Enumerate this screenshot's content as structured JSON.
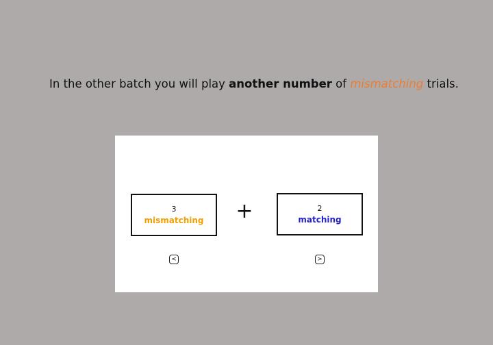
{
  "instruction": {
    "prefix": "In the other batch you will play ",
    "emphasis": "another number",
    "middle": " of ",
    "highlight": "mismatching",
    "suffix": " trials."
  },
  "options": [
    {
      "count": "3",
      "label": "mismatching",
      "key": "<"
    },
    {
      "count": "2",
      "label": "matching",
      "key": ">"
    }
  ],
  "operator": "+",
  "colors": {
    "background": "#aeaaaa",
    "mismatching_highlight": "#ed7d31",
    "mismatching_label": "#f0a000",
    "matching_label": "#2424c8"
  }
}
